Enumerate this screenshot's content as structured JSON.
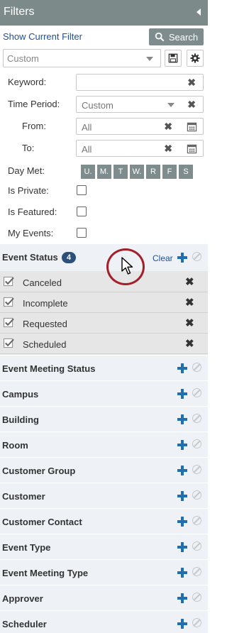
{
  "panel": {
    "title": "Filters"
  },
  "toolbar": {
    "show_filter_label": "Show Current Filter",
    "search_label": "Search",
    "saved_filter_value": "Custom"
  },
  "form": {
    "keyword_label": "Keyword:",
    "keyword_value": "",
    "time_period_label": "Time Period:",
    "time_period_value": "Custom",
    "from_label": "From:",
    "from_value": "All",
    "to_label": "To:",
    "to_value": "All",
    "day_met_label": "Day Met:",
    "days": [
      "U.",
      "M.",
      "T",
      "W.",
      "R",
      "F",
      "S"
    ],
    "is_private_label": "Is Private:",
    "is_featured_label": "Is Featured:",
    "my_events_label": "My Events:"
  },
  "event_status": {
    "title": "Event Status",
    "count": "4",
    "clear_label": "Clear",
    "items": [
      "Canceled",
      "Incomplete",
      "Requested",
      "Scheduled"
    ]
  },
  "sections": [
    "Event Meeting Status",
    "Campus",
    "Building",
    "Room",
    "Customer Group",
    "Customer",
    "Customer Contact",
    "Event Type",
    "Event Meeting Type",
    "Approver",
    "Scheduler"
  ],
  "icons": {
    "collapse": "triangle-left-icon",
    "search": "search-icon",
    "save": "floppy-disk-icon",
    "settings": "gear-icon",
    "clear": "x-icon",
    "calendar": "calendar-icon",
    "add": "plus-icon",
    "disable": "ban-icon",
    "checked": "checkmark-icon"
  },
  "colors": {
    "header_bg": "#7d8a8a",
    "link": "#1f4e9b",
    "badge_bg": "#2d4f7c",
    "plus": "#1f6fb2",
    "highlight_ring": "#a31f2a"
  }
}
